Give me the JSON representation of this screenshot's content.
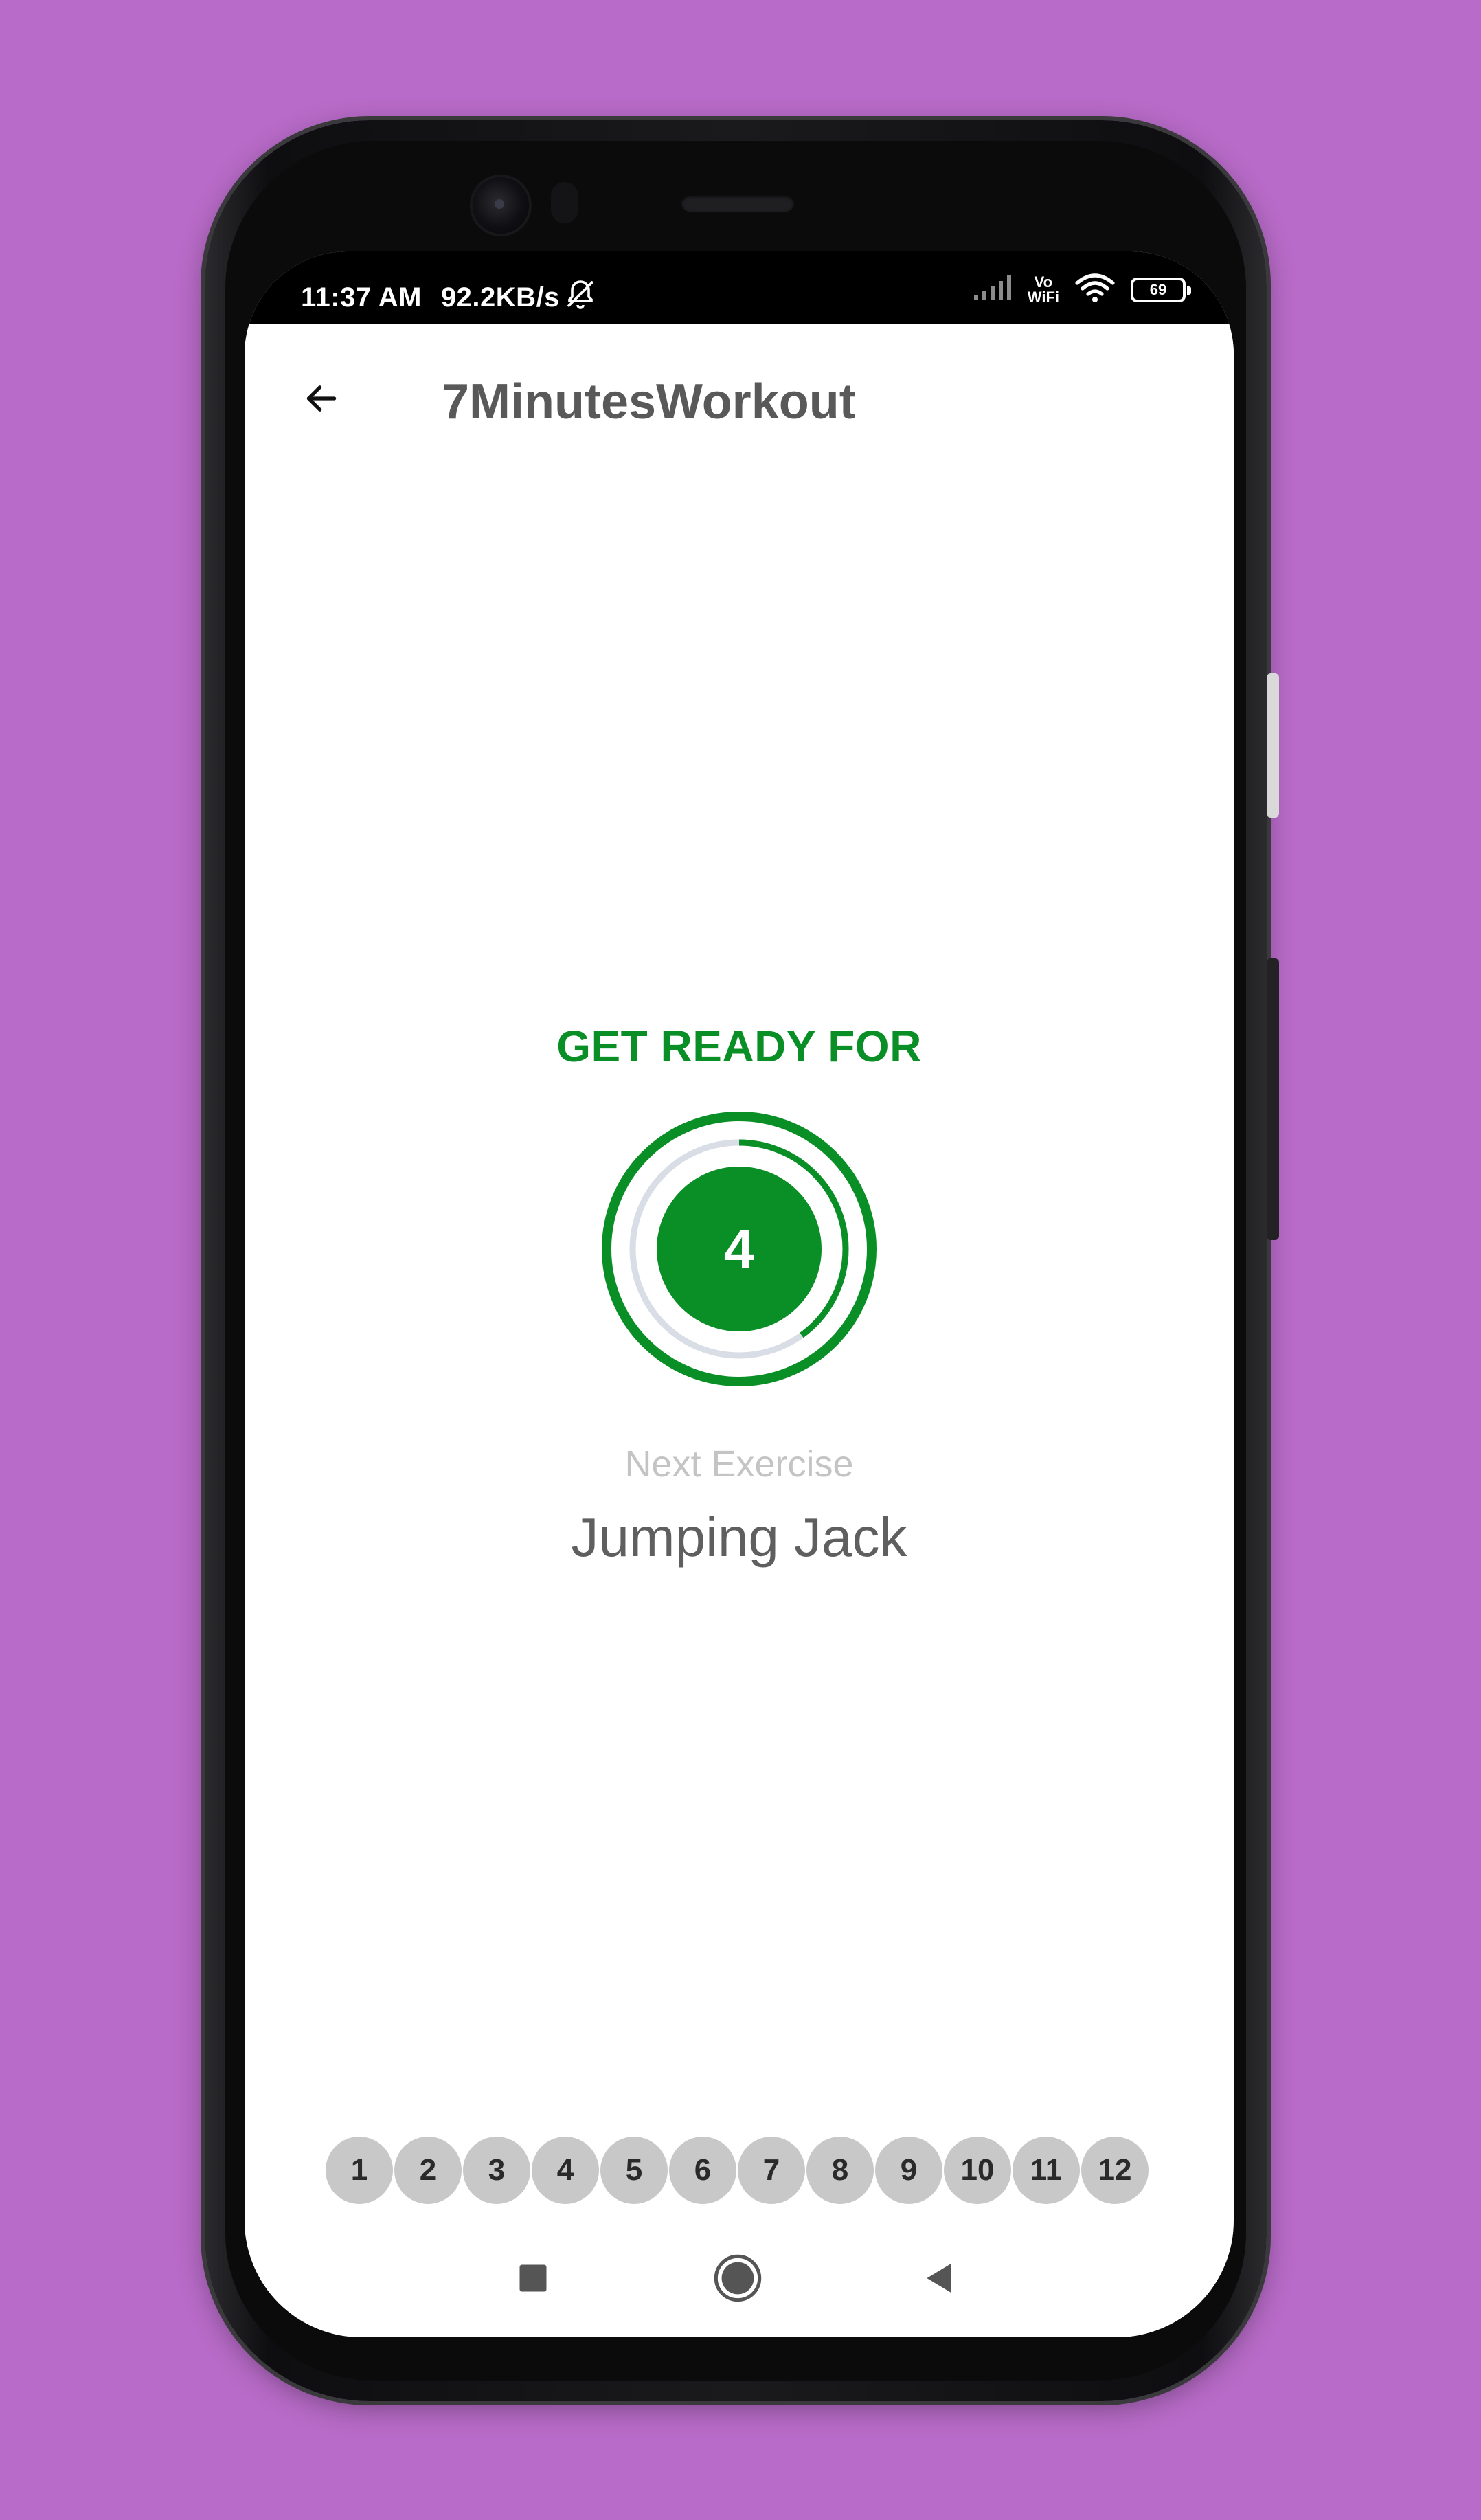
{
  "status_bar": {
    "time": "11:37 AM",
    "network_speed": "92.2KB/s",
    "vowifi_top": "Vo",
    "vowifi_bottom": "WiFi",
    "battery": "69"
  },
  "app_bar": {
    "title": "7MinutesWorkout",
    "back_icon": "arrow-left-icon"
  },
  "rest_view": {
    "heading": "GET READY FOR",
    "timer_value": "4",
    "timer_progress": 0.4,
    "next_label": "Next Exercise",
    "next_exercise": "Jumping Jack"
  },
  "exercise_progress": [
    "1",
    "2",
    "3",
    "4",
    "5",
    "6",
    "7",
    "8",
    "9",
    "10",
    "11",
    "12"
  ],
  "nav_bar": {
    "recent_icon": "square-recent-icon",
    "home_icon": "circle-home-icon",
    "back_icon": "triangle-back-icon"
  },
  "colors": {
    "accent_green": "#0a8f27",
    "background_purple": "#b86bc8",
    "bubble_gray": "#c8c8c8"
  }
}
